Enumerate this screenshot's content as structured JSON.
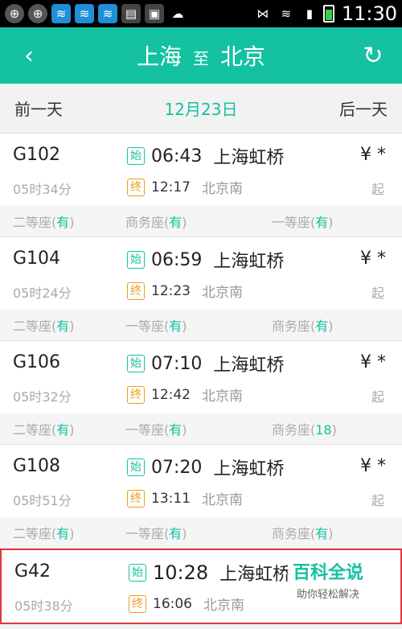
{
  "statusbar": {
    "time": "11:30"
  },
  "titlebar": {
    "back_icon": "‹",
    "from": "上海",
    "to_label": "至",
    "dest": "北京",
    "refresh_icon": "↻"
  },
  "datebar": {
    "prev": "前一天",
    "date": "12月23日",
    "next": "后一天"
  },
  "trains": [
    {
      "num": "G102",
      "duration": "05时34分",
      "start_badge": "始",
      "dep_time": "06:43",
      "dep_station": "上海虹桥",
      "end_badge": "终",
      "arr_time": "12:17",
      "arr_station": "北京南",
      "price": "¥ *",
      "qi": "起",
      "seats": [
        {
          "name": "二等座(",
          "count": "有",
          "close": ")"
        },
        {
          "name": "商务座(",
          "count": "有",
          "close": ")"
        },
        {
          "name": "一等座(",
          "count": "有",
          "close": ")"
        }
      ]
    },
    {
      "num": "G104",
      "duration": "05时24分",
      "start_badge": "始",
      "dep_time": "06:59",
      "dep_station": "上海虹桥",
      "end_badge": "终",
      "arr_time": "12:23",
      "arr_station": "北京南",
      "price": "¥ *",
      "qi": "起",
      "seats": [
        {
          "name": "二等座(",
          "count": "有",
          "close": ")"
        },
        {
          "name": "一等座(",
          "count": "有",
          "close": ")"
        },
        {
          "name": "商务座(",
          "count": "有",
          "close": ")"
        }
      ]
    },
    {
      "num": "G106",
      "duration": "05时32分",
      "start_badge": "始",
      "dep_time": "07:10",
      "dep_station": "上海虹桥",
      "end_badge": "终",
      "arr_time": "12:42",
      "arr_station": "北京南",
      "price": "¥ *",
      "qi": "起",
      "seats": [
        {
          "name": "二等座(",
          "count": "有",
          "close": ")"
        },
        {
          "name": "一等座(",
          "count": "有",
          "close": ")"
        },
        {
          "name": "商务座(",
          "count": "18",
          "close": ")"
        }
      ]
    },
    {
      "num": "G108",
      "duration": "05时51分",
      "start_badge": "始",
      "dep_time": "07:20",
      "dep_station": "上海虹桥",
      "end_badge": "终",
      "arr_time": "13:11",
      "arr_station": "北京南",
      "price": "¥ *",
      "qi": "起",
      "seats": [
        {
          "name": "二等座(",
          "count": "有",
          "close": ")"
        },
        {
          "name": "一等座(",
          "count": "有",
          "close": ")"
        },
        {
          "name": "商务座(",
          "count": "有",
          "close": ")"
        }
      ]
    },
    {
      "num": "G42",
      "duration": "05时38分",
      "start_badge": "始",
      "dep_time": "10:28",
      "dep_station": "上海虹桥",
      "end_badge": "终",
      "arr_time": "16:06",
      "arr_station": "北京南",
      "price": "",
      "qi": "",
      "seats": []
    }
  ],
  "watermark": {
    "main": "百科全说",
    "sub": "助你轻松解决"
  },
  "colors": {
    "accent": "#14c1a1",
    "end_badge": "#f09a1a",
    "highlight_border": "#e0363f"
  }
}
